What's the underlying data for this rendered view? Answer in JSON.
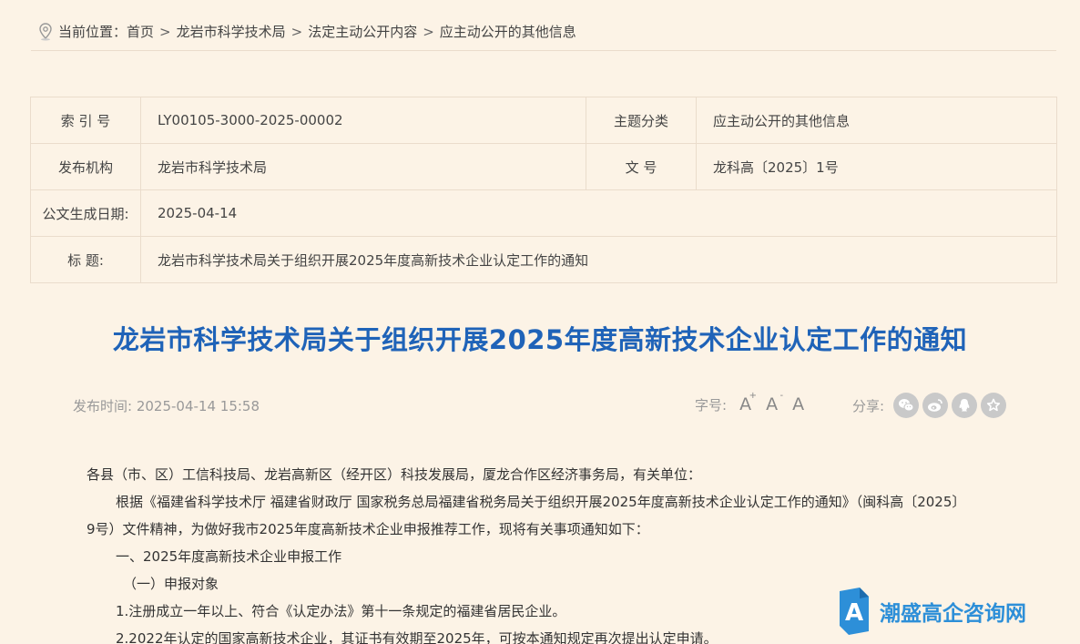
{
  "breadcrumb": {
    "prefix": "当前位置：",
    "items": [
      "首页",
      "龙岩市科学技术局",
      "法定主动公开内容",
      "应主动公开的其他信息"
    ],
    "separator": ">"
  },
  "meta": {
    "index_label": "索 引 号",
    "index_value": "LY00105-3000-2025-00002",
    "category_label": "主题分类",
    "category_value": "应主动公开的其他信息",
    "issuer_label": "发布机构",
    "issuer_value": "龙岩市科学技术局",
    "docno_label": "文 号",
    "docno_value": "龙科高〔2025〕1号",
    "date_label": "公文生成日期:",
    "date_value": "2025-04-14",
    "title_label": "标 题:",
    "title_value": "龙岩市科学技术局关于组织开展2025年度高新技术企业认定工作的通知"
  },
  "article": {
    "title": "龙岩市科学技术局关于组织开展2025年度高新技术企业认定工作的通知",
    "publish_label": "发布时间:",
    "publish_time": "2025-04-14 15:58",
    "fontsize_label": "字号:",
    "font_buttons": [
      "A",
      "A",
      "A"
    ],
    "font_sup": [
      "+",
      "-"
    ],
    "share_label": "分享:",
    "paragraphs": [
      "各县（市、区）工信科技局、龙岩高新区（经开区）科技发展局，厦龙合作区经济事务局，有关单位：",
      "根据《福建省科学技术厅 福建省财政厅 国家税务总局福建省税务局关于组织开展2025年度高新技术企业认定工作的通知》（闽科高〔2025〕9号）文件精神，为做好我市2025年度高新技术企业申报推荐工作，现将有关事项通知如下：",
      "一、2025年度高新技术企业申报工作",
      "（一）申报对象",
      "1.注册成立一年以上、符合《认定办法》第十一条规定的福建省居民企业。",
      "2.2022年认定的国家高新技术企业，其证书有效期至2025年，可按本通知规定再次提出认定申请。"
    ]
  },
  "watermark": {
    "letter": "A",
    "text": "潮盛高企咨询网"
  },
  "colors": {
    "background": "#fcf3e6",
    "title": "#1f63b8",
    "border": "#eadccc",
    "watermark": "#2d8fd8"
  }
}
